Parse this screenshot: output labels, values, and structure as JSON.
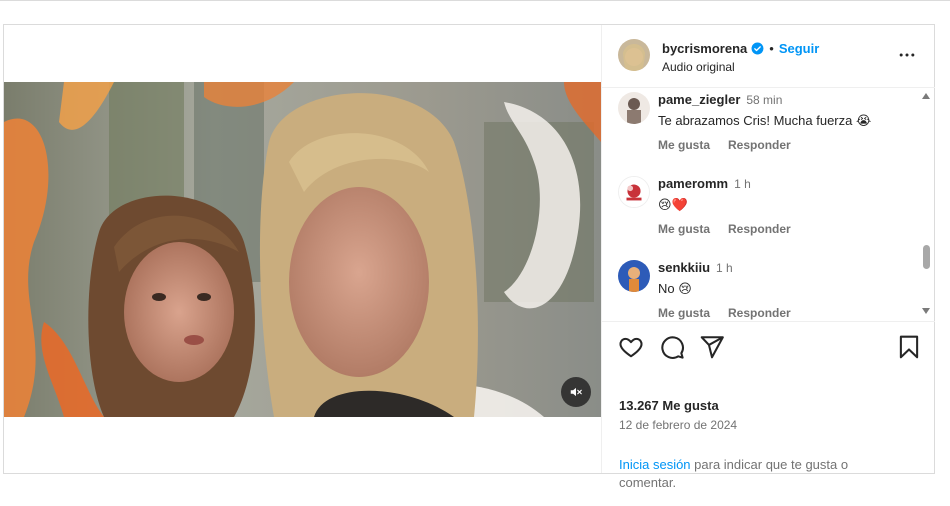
{
  "colors": {
    "link": "#0095f6",
    "verified": "#0095f6",
    "muted_text": "#737373",
    "border": "#dbdbdb"
  },
  "post": {
    "author": "bycrismorena",
    "verified_icon": "verified-badge-icon",
    "follow_label": "Seguir",
    "audio": "Audio original",
    "more_icon": "more-options-icon"
  },
  "comments": [
    {
      "user": "pame_ziegler",
      "time": "58 min",
      "text": "Te abrazamos Cris! Mucha fuerza 😭",
      "like_label": "Me gusta",
      "reply_label": "Responder"
    },
    {
      "user": "pameromm",
      "time": "1 h",
      "text": "😢❤️",
      "like_label": "Me gusta",
      "reply_label": "Responder"
    },
    {
      "user": "senkkiiu",
      "time": "1 h",
      "text": "No 😢",
      "like_label": "Me gusta",
      "reply_label": "Responder"
    }
  ],
  "actions": {
    "like_icon": "heart-icon",
    "comment_icon": "comment-icon",
    "share_icon": "share-icon",
    "save_icon": "bookmark-icon"
  },
  "likes": "13.267 Me gusta",
  "date": "12 de febrero de 2024",
  "login_prompt": {
    "link": "Inicia sesión",
    "text": " para indicar que te gusta o comentar."
  },
  "media": {
    "mute_icon": "muted-speaker-icon"
  }
}
